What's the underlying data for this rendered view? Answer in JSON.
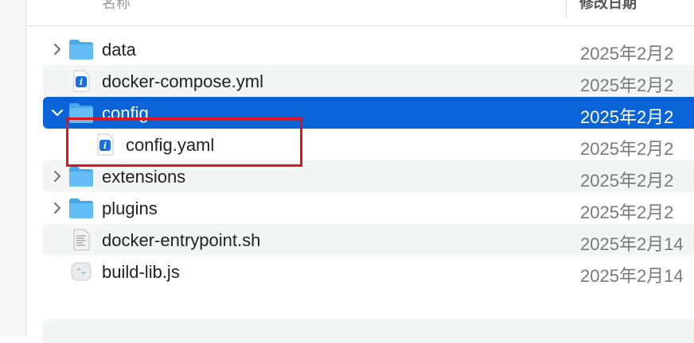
{
  "header": {
    "name_column": "名称",
    "date_column": "修改日期"
  },
  "files": [
    {
      "name": "data",
      "date": "2025年2月2",
      "kind": "folder",
      "expand": "collapsed",
      "icon": "folder-icon"
    },
    {
      "name": "docker-compose.yml",
      "date": "2025年2月2",
      "kind": "yaml",
      "icon": "yaml-file-icon"
    },
    {
      "name": "config",
      "date": "2025年2月2",
      "kind": "folder",
      "expand": "expanded",
      "selected": true,
      "icon": "folder-icon"
    },
    {
      "name": "config.yaml",
      "date": "2025年2月2",
      "kind": "yaml",
      "nested": true,
      "icon": "yaml-file-icon"
    },
    {
      "name": "extensions",
      "date": "2025年2月2",
      "kind": "folder",
      "expand": "collapsed",
      "icon": "folder-icon"
    },
    {
      "name": "plugins",
      "date": "2025年2月2",
      "kind": "folder",
      "expand": "collapsed",
      "icon": "folder-icon"
    },
    {
      "name": "docker-entrypoint.sh",
      "date": "2025年2月14",
      "kind": "script",
      "icon": "shell-script-icon"
    },
    {
      "name": "build-lib.js",
      "date": "2025年2月14",
      "kind": "js",
      "icon": "javascript-file-icon"
    }
  ],
  "colors": {
    "selection": "#0b63d8",
    "highlight": "#e0141c",
    "folder": "#5fb8f2"
  }
}
